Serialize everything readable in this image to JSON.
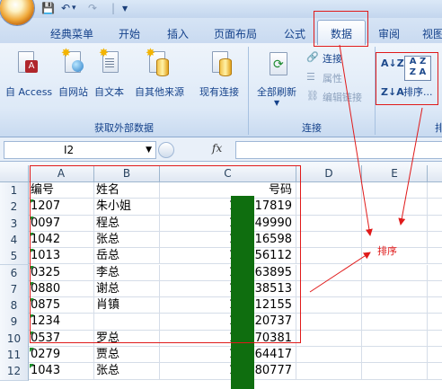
{
  "quick_access": {
    "save_icon": "save-icon",
    "undo_icon": "undo-icon",
    "redo_icon": "redo-icon",
    "separator": "|",
    "customize": "▼"
  },
  "tabs": [
    "经典菜单",
    "开始",
    "插入",
    "页面布局",
    "公式",
    "数据",
    "审阅",
    "视图"
  ],
  "active_tab": "数据",
  "ribbon": {
    "get_external": {
      "buttons": [
        "自 Access",
        "自网站",
        "自文本",
        "自其他来源",
        "现有连接"
      ],
      "group_label": "获取外部数据"
    },
    "connections": {
      "refresh_all": "全部刷新",
      "refresh_caret": "▼",
      "connections": "连接",
      "properties": "属性",
      "edit_links": "编辑链接",
      "group_label": "连接"
    },
    "sort": {
      "az": "A↓Z",
      "za": "Z↓A",
      "sort_label": "排序...",
      "group_label_partial": "排"
    }
  },
  "formula_bar": {
    "name_box": "I2",
    "fx": "fx",
    "value": ""
  },
  "columns": [
    "A",
    "B",
    "C",
    "D",
    "E"
  ],
  "rows": [
    {
      "n": "1",
      "a": "编号",
      "b": "姓名",
      "c": "号码",
      "marked": false
    },
    {
      "n": "2",
      "a": "1207",
      "b": "朱小姐",
      "c": "13 717819",
      "marked": true
    },
    {
      "n": "3",
      "a": "0097",
      "b": "程总",
      "c": "13 149990",
      "marked": true
    },
    {
      "n": "4",
      "a": "1042",
      "b": "张总",
      "c": "13 516598",
      "marked": true
    },
    {
      "n": "5",
      "a": "1013",
      "b": "岳总",
      "c": "13 556112",
      "marked": true
    },
    {
      "n": "6",
      "a": "0325",
      "b": "李总",
      "c": "13 563895",
      "marked": true
    },
    {
      "n": "7",
      "a": "0880",
      "b": "谢总",
      "c": "13 938513",
      "marked": true
    },
    {
      "n": "8",
      "a": "0875",
      "b": "肖镇",
      "c": "13 912155",
      "marked": true
    },
    {
      "n": "9",
      "a": "1234",
      "b": "",
      "c": "13 520737",
      "marked": true
    },
    {
      "n": "10",
      "a": "0537",
      "b": "罗总",
      "c": "13 770381",
      "marked": true
    },
    {
      "n": "11",
      "a": "0279",
      "b": "贾总",
      "c": "13 064417",
      "marked": true
    },
    {
      "n": "12",
      "a": "1043",
      "b": "张总",
      "c": "13 080777",
      "marked": true
    }
  ],
  "annotation": {
    "text": "排序",
    "color": "#e01a1a"
  },
  "colors": {
    "ribbon_text": "#15428b",
    "redaction": "#0f6e0f",
    "annotation": "#e01a1a"
  }
}
